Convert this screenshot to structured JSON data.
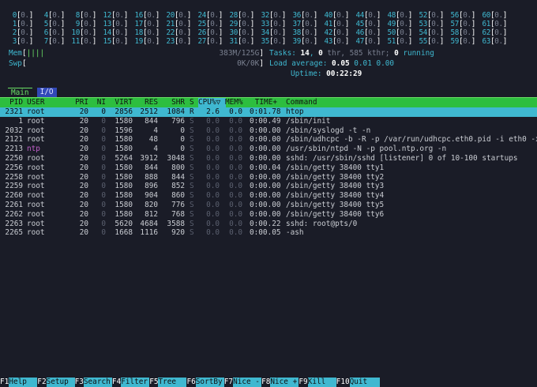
{
  "cpus": {
    "rows": [
      [
        "0",
        "4",
        "8",
        "12",
        "16",
        "20",
        "24",
        "28",
        "32",
        "36",
        "40",
        "44",
        "48",
        "52",
        "56",
        "60"
      ],
      [
        "1",
        "5",
        "9",
        "13",
        "17",
        "21",
        "25",
        "29",
        "33",
        "37",
        "41",
        "45",
        "49",
        "53",
        "57",
        "61"
      ],
      [
        "2",
        "6",
        "10",
        "14",
        "18",
        "22",
        "26",
        "30",
        "34",
        "38",
        "42",
        "46",
        "50",
        "54",
        "58",
        "62"
      ],
      [
        "3",
        "7",
        "11",
        "15",
        "19",
        "23",
        "27",
        "31",
        "35",
        "39",
        "43",
        "47",
        "51",
        "55",
        "59",
        "63"
      ]
    ],
    "bracket_open": "[",
    "bracket_close": "]",
    "value": "0.",
    "pct_sign": ""
  },
  "mem": {
    "label": "Mem",
    "bar_open": "[",
    "bar_fill": "||||",
    "used": "383M/125G",
    "bar_close": "]"
  },
  "swp": {
    "label": "Swp",
    "bar_open": "[",
    "used": "0K/0K",
    "bar_close": "]"
  },
  "stats": {
    "tasks_label": "Tasks: ",
    "tasks_count": "14",
    "tasks_sep": ", ",
    "thr_count": "0",
    "thr_text": " thr, 585 kthr; ",
    "running_count": "0",
    "running_text": " running",
    "load_label": "Load average: ",
    "load1": "0.05",
    "load5": "0.01",
    "load15": "0.00",
    "uptime_label": "Uptime: ",
    "uptime_value": "00:22:29"
  },
  "tabs": {
    "main": "Main",
    "io": "I/O"
  },
  "columns": {
    "pid": "PID",
    "user": "USER",
    "pri": "PRI",
    "ni": "NI",
    "virt": "VIRT",
    "res": "RES",
    "shr": "SHR",
    "s": "S",
    "cpu": "CPU%",
    "cpu_arrow": "▽",
    "mem": "MEM%",
    "time": "TIME+",
    "command": "Command"
  },
  "processes": [
    {
      "pid": "2321",
      "user": "root",
      "pri": "20",
      "ni": "0",
      "virt": "2856",
      "res": "2512",
      "shr": "1084",
      "s": "R",
      "cpu": "2.6",
      "mem": "0.0",
      "time": "0:01.78",
      "cmd": "htop"
    },
    {
      "pid": "1",
      "user": "root",
      "pri": "20",
      "ni": "0",
      "virt": "1580",
      "res": "844",
      "shr": "796",
      "s": "S",
      "cpu": "0.0",
      "mem": "0.0",
      "time": "0:00.49",
      "cmd": "/sbin/init"
    },
    {
      "pid": "2032",
      "user": "root",
      "pri": "20",
      "ni": "0",
      "virt": "1596",
      "res": "4",
      "shr": "0",
      "s": "S",
      "cpu": "0.0",
      "mem": "0.0",
      "time": "0:00.00",
      "cmd": "/sbin/syslogd -t -n"
    },
    {
      "pid": "2121",
      "user": "root",
      "pri": "20",
      "ni": "0",
      "virt": "1580",
      "res": "48",
      "shr": "0",
      "s": "S",
      "cpu": "0.0",
      "mem": "0.0",
      "time": "0:00.00",
      "cmd": "/sbin/udhcpc -b -R -p /var/run/udhcpc.eth0.pid -i eth0 -x"
    },
    {
      "pid": "2213",
      "user": "ntp",
      "pri": "20",
      "ni": "0",
      "virt": "1580",
      "res": "4",
      "shr": "0",
      "s": "S",
      "cpu": "0.0",
      "mem": "0.0",
      "time": "0:00.00",
      "cmd": "/usr/sbin/ntpd -N -p pool.ntp.org -n"
    },
    {
      "pid": "2250",
      "user": "root",
      "pri": "20",
      "ni": "0",
      "virt": "5264",
      "res": "3912",
      "shr": "3048",
      "s": "S",
      "cpu": "0.0",
      "mem": "0.0",
      "time": "0:00.00",
      "cmd": "sshd: /usr/sbin/sshd [listener] 0 of 10-100 startups"
    },
    {
      "pid": "2256",
      "user": "root",
      "pri": "20",
      "ni": "0",
      "virt": "1580",
      "res": "844",
      "shr": "800",
      "s": "S",
      "cpu": "0.0",
      "mem": "0.0",
      "time": "0:00.04",
      "cmd": "/sbin/getty 38400 tty1"
    },
    {
      "pid": "2258",
      "user": "root",
      "pri": "20",
      "ni": "0",
      "virt": "1580",
      "res": "888",
      "shr": "844",
      "s": "S",
      "cpu": "0.0",
      "mem": "0.0",
      "time": "0:00.00",
      "cmd": "/sbin/getty 38400 tty2"
    },
    {
      "pid": "2259",
      "user": "root",
      "pri": "20",
      "ni": "0",
      "virt": "1580",
      "res": "896",
      "shr": "852",
      "s": "S",
      "cpu": "0.0",
      "mem": "0.0",
      "time": "0:00.00",
      "cmd": "/sbin/getty 38400 tty3"
    },
    {
      "pid": "2260",
      "user": "root",
      "pri": "20",
      "ni": "0",
      "virt": "1580",
      "res": "904",
      "shr": "860",
      "s": "S",
      "cpu": "0.0",
      "mem": "0.0",
      "time": "0:00.00",
      "cmd": "/sbin/getty 38400 tty4"
    },
    {
      "pid": "2261",
      "user": "root",
      "pri": "20",
      "ni": "0",
      "virt": "1580",
      "res": "820",
      "shr": "776",
      "s": "S",
      "cpu": "0.0",
      "mem": "0.0",
      "time": "0:00.00",
      "cmd": "/sbin/getty 38400 tty5"
    },
    {
      "pid": "2262",
      "user": "root",
      "pri": "20",
      "ni": "0",
      "virt": "1580",
      "res": "812",
      "shr": "768",
      "s": "S",
      "cpu": "0.0",
      "mem": "0.0",
      "time": "0:00.00",
      "cmd": "/sbin/getty 38400 tty6"
    },
    {
      "pid": "2263",
      "user": "root",
      "pri": "20",
      "ni": "0",
      "virt": "5620",
      "res": "4684",
      "shr": "3588",
      "s": "S",
      "cpu": "0.0",
      "mem": "0.0",
      "time": "0:00.22",
      "cmd": "sshd: root@pts/0"
    },
    {
      "pid": "2265",
      "user": "root",
      "pri": "20",
      "ni": "0",
      "virt": "1668",
      "res": "1116",
      "shr": "920",
      "s": "S",
      "cpu": "0.0",
      "mem": "0.0",
      "time": "0:00.05",
      "cmd": "-ash"
    }
  ],
  "footer": [
    {
      "key": "F1",
      "label": "Help  "
    },
    {
      "key": "F2",
      "label": "Setup "
    },
    {
      "key": "F3",
      "label": "Search"
    },
    {
      "key": "F4",
      "label": "Filter"
    },
    {
      "key": "F5",
      "label": "Tree  "
    },
    {
      "key": "F6",
      "label": "SortBy"
    },
    {
      "key": "F7",
      "label": "Nice -"
    },
    {
      "key": "F8",
      "label": "Nice +"
    },
    {
      "key": "F9",
      "label": "Kill  "
    },
    {
      "key": "F10",
      "label": "Quit  "
    }
  ],
  "colors": {
    "background": "#1a1c27",
    "cyan": "#3fb8d0",
    "green": "#2dbe3f",
    "io_tab": "#3148b8",
    "ntp_user": "#c060c8"
  }
}
